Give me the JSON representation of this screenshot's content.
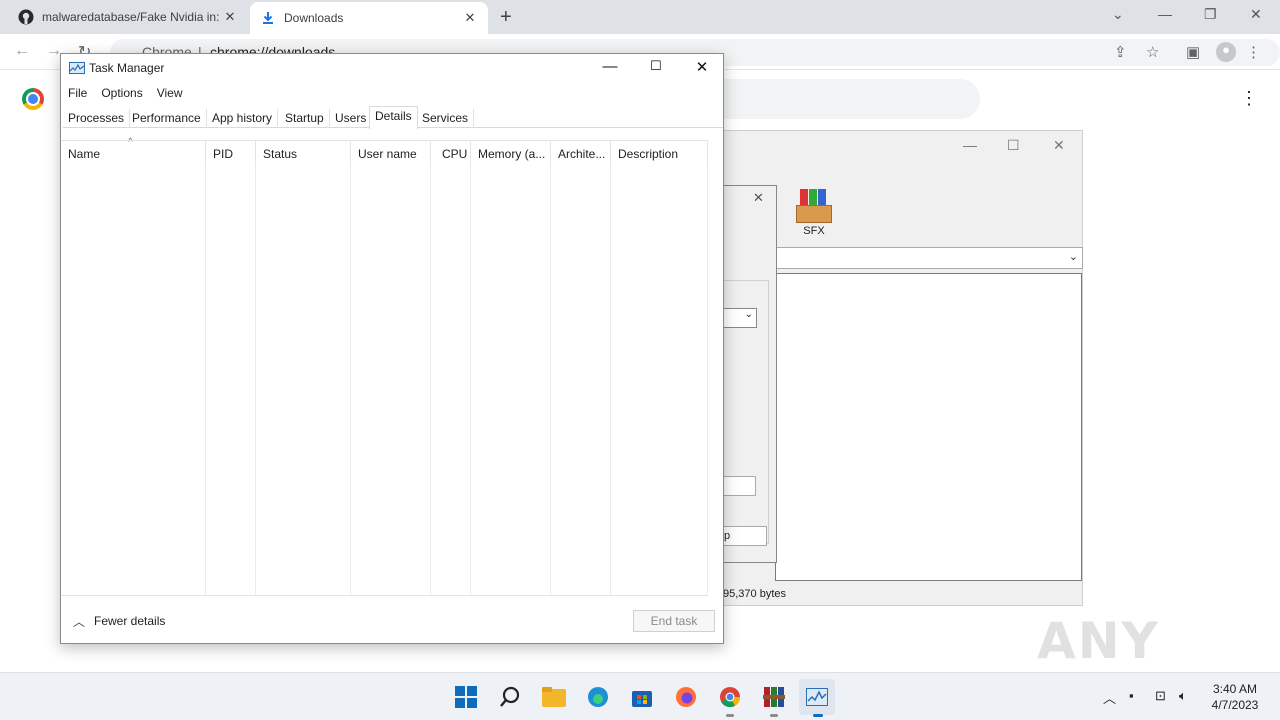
{
  "browser": {
    "tabs": [
      {
        "title": "malwaredatabase/Fake Nvidia in:",
        "icon": "github-icon"
      },
      {
        "title": "Downloads",
        "icon": "download-icon"
      }
    ],
    "new_tab": "+",
    "omnibox": {
      "site_label": "Chrome",
      "separator": "|",
      "url": "chrome://downloads"
    }
  },
  "task_manager": {
    "title": "Task Manager",
    "menu": [
      "File",
      "Options",
      "View"
    ],
    "tabs": [
      "Processes",
      "Performance",
      "App history",
      "Startup",
      "Users",
      "Details",
      "Services"
    ],
    "active_tab": "Details",
    "columns": [
      "Name",
      "PID",
      "Status",
      "User name",
      "CPU",
      "Memory (a...",
      "Archite...",
      "Description"
    ],
    "footer": {
      "fewer_details": "Fewer details",
      "end_task": "End task"
    }
  },
  "winrar": {
    "sfx_label": "SFX",
    "status_text": "95,370 bytes",
    "dialog_button_fragment": "p"
  },
  "watermark": "ANY RUN",
  "taskbar": {
    "time": "3:40 AM",
    "date": "4/7/2023"
  }
}
